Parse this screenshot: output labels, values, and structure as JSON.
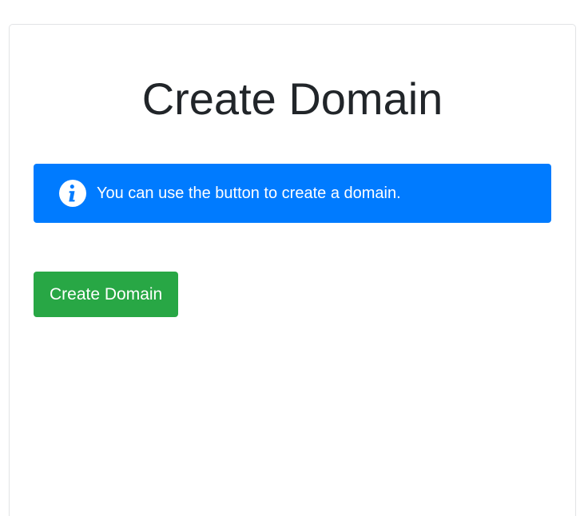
{
  "page": {
    "title": "Create Domain"
  },
  "alert": {
    "icon": "info-icon",
    "message": "You can use the button to create a domain.",
    "color": "#007bff"
  },
  "actions": {
    "create_label": "Create Domain",
    "create_color": "#28a745"
  }
}
